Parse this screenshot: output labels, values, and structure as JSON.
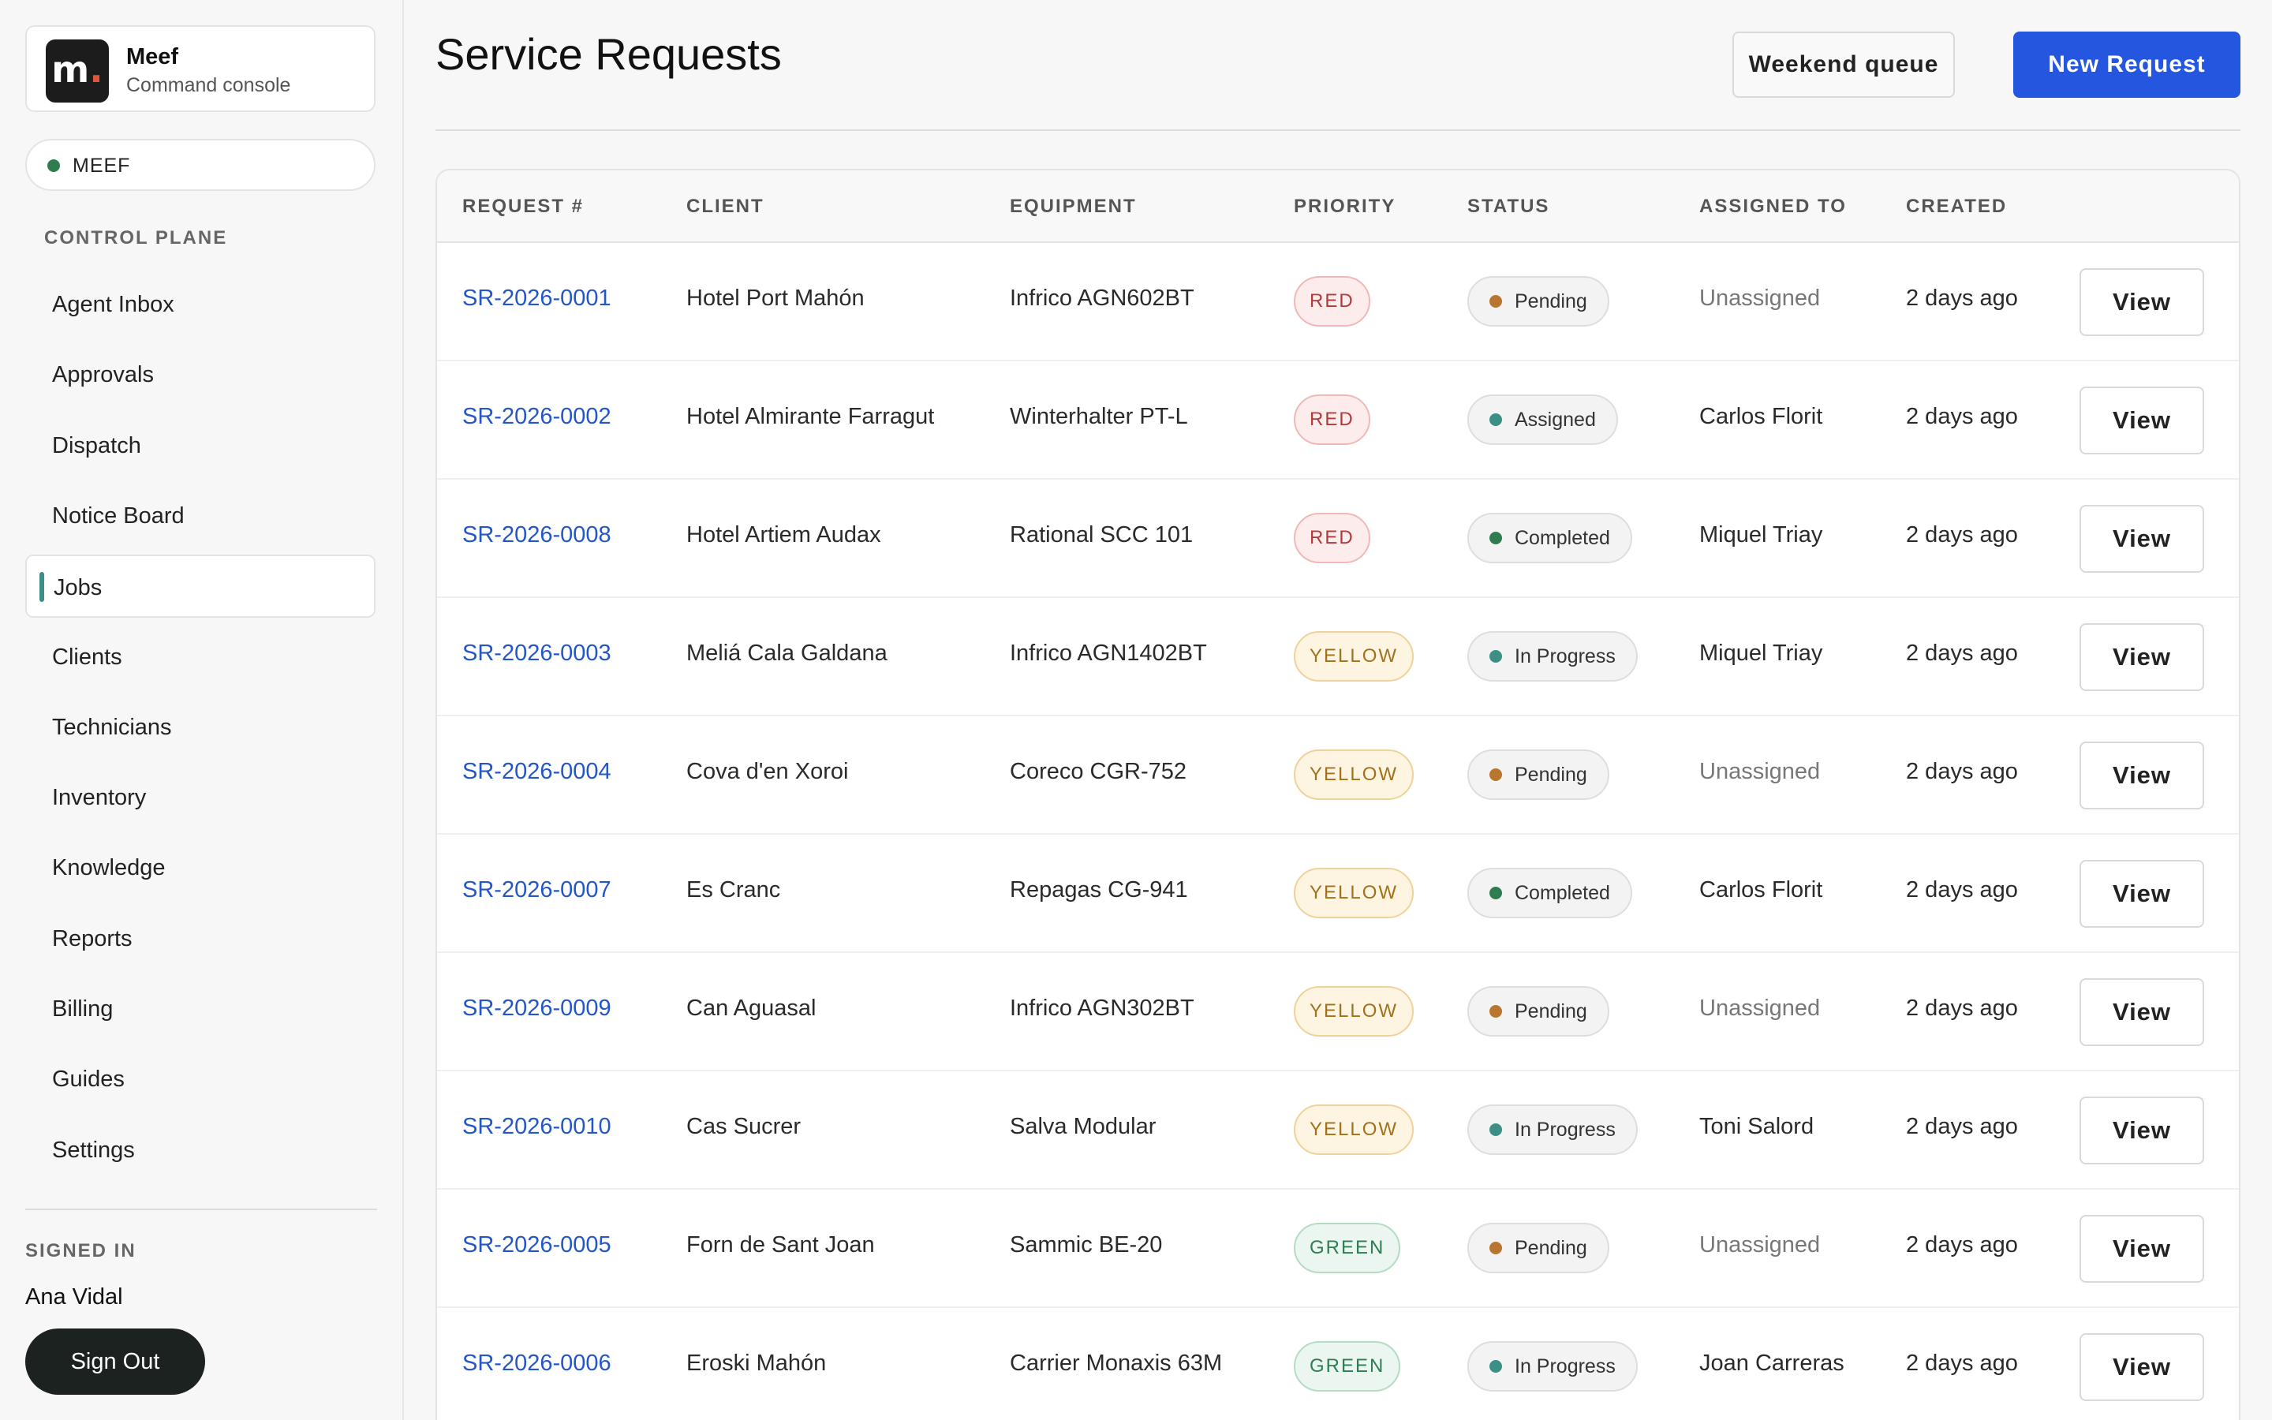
{
  "brand": {
    "logo_letter": "m",
    "logo_dot": ".",
    "name": "Meef",
    "subtitle": "Command console"
  },
  "environment": {
    "label": "MEEF",
    "status_color": "#2f7d4f"
  },
  "sidebar": {
    "section_title": "CONTROL PLANE",
    "items": [
      {
        "label": "Agent Inbox",
        "active": false
      },
      {
        "label": "Approvals",
        "active": false
      },
      {
        "label": "Dispatch",
        "active": false
      },
      {
        "label": "Notice Board",
        "active": false
      },
      {
        "label": "Jobs",
        "active": true
      },
      {
        "label": "Clients",
        "active": false
      },
      {
        "label": "Technicians",
        "active": false
      },
      {
        "label": "Inventory",
        "active": false
      },
      {
        "label": "Knowledge",
        "active": false
      },
      {
        "label": "Reports",
        "active": false
      },
      {
        "label": "Billing",
        "active": false
      },
      {
        "label": "Guides",
        "active": false
      },
      {
        "label": "Settings",
        "active": false
      }
    ],
    "signed_in_title": "SIGNED IN",
    "user_name": "Ana Vidal",
    "sign_out_label": "Sign Out"
  },
  "header": {
    "title": "Service Requests",
    "secondary_button": "Weekend queue",
    "primary_button": "New Request"
  },
  "colors": {
    "primary": "#2456e0",
    "link": "#2456c8",
    "status_pending": "#b8762e",
    "status_active": "#3b8f84",
    "status_completed": "#2f7d4f"
  },
  "table": {
    "columns": [
      "REQUEST #",
      "CLIENT",
      "EQUIPMENT",
      "PRIORITY",
      "STATUS",
      "ASSIGNED TO",
      "CREATED"
    ],
    "view_label": "View",
    "rows": [
      {
        "id": "SR-2026-0001",
        "client": "Hotel Port Mahón",
        "equipment": "Infrico AGN602BT",
        "priority": "RED",
        "status": "Pending",
        "assigned": "Unassigned",
        "created": "2 days ago"
      },
      {
        "id": "SR-2026-0002",
        "client": "Hotel Almirante Farragut",
        "equipment": "Winterhalter PT-L",
        "priority": "RED",
        "status": "Assigned",
        "assigned": "Carlos Florit",
        "created": "2 days ago"
      },
      {
        "id": "SR-2026-0008",
        "client": "Hotel Artiem Audax",
        "equipment": "Rational SCC 101",
        "priority": "RED",
        "status": "Completed",
        "assigned": "Miquel Triay",
        "created": "2 days ago"
      },
      {
        "id": "SR-2026-0003",
        "client": "Meliá Cala Galdana",
        "equipment": "Infrico AGN1402BT",
        "priority": "YELLOW",
        "status": "In Progress",
        "assigned": "Miquel Triay",
        "created": "2 days ago"
      },
      {
        "id": "SR-2026-0004",
        "client": "Cova d'en Xoroi",
        "equipment": "Coreco CGR-752",
        "priority": "YELLOW",
        "status": "Pending",
        "assigned": "Unassigned",
        "created": "2 days ago"
      },
      {
        "id": "SR-2026-0007",
        "client": "Es Cranc",
        "equipment": "Repagas CG-941",
        "priority": "YELLOW",
        "status": "Completed",
        "assigned": "Carlos Florit",
        "created": "2 days ago"
      },
      {
        "id": "SR-2026-0009",
        "client": "Can Aguasal",
        "equipment": "Infrico AGN302BT",
        "priority": "YELLOW",
        "status": "Pending",
        "assigned": "Unassigned",
        "created": "2 days ago"
      },
      {
        "id": "SR-2026-0010",
        "client": "Cas Sucrer",
        "equipment": "Salva Modular",
        "priority": "YELLOW",
        "status": "In Progress",
        "assigned": "Toni Salord",
        "created": "2 days ago"
      },
      {
        "id": "SR-2026-0005",
        "client": "Forn de Sant Joan",
        "equipment": "Sammic BE-20",
        "priority": "GREEN",
        "status": "Pending",
        "assigned": "Unassigned",
        "created": "2 days ago"
      },
      {
        "id": "SR-2026-0006",
        "client": "Eroski Mahón",
        "equipment": "Carrier Monaxis 63M",
        "priority": "GREEN",
        "status": "In Progress",
        "assigned": "Joan Carreras",
        "created": "2 days ago"
      }
    ]
  }
}
